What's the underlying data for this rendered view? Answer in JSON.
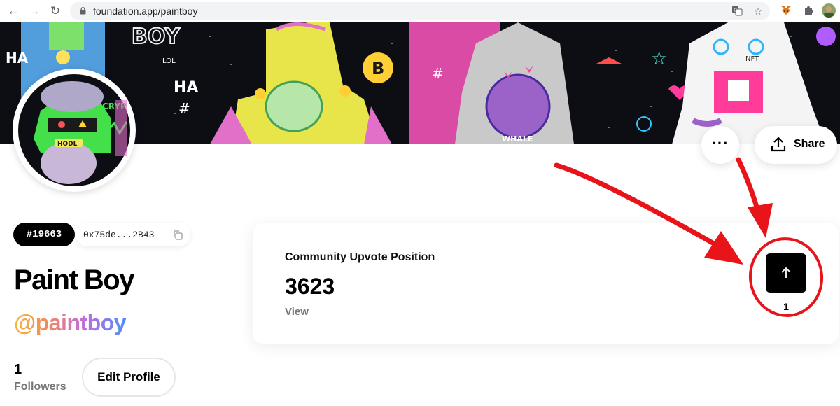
{
  "browser": {
    "url": "foundation.app/paintboy"
  },
  "profile": {
    "number_badge": "#19663",
    "wallet_address": "0x75de...2B43",
    "display_name": "Paint Boy",
    "username": "@paintboy",
    "followers_count": "1",
    "followers_label": "Followers",
    "edit_profile_label": "Edit Profile"
  },
  "actions": {
    "share_label": "Share"
  },
  "upvote_card": {
    "title": "Community Upvote Position",
    "position_value": "3623",
    "view_link": "View",
    "upvote_count": "1"
  },
  "colors": {
    "annotation": "#e8141a",
    "button_dark": "#000000",
    "username_gradient": [
      "#f5b53d",
      "#f08a5d",
      "#c86dd7",
      "#4f8df7"
    ]
  },
  "icons": [
    "back-arrow-icon",
    "forward-arrow-icon",
    "reload-icon",
    "lock-icon",
    "translate-icon",
    "bookmark-star-icon",
    "metamask-fox-icon",
    "extensions-puzzle-icon",
    "user-avatar-icon",
    "more-dots-icon",
    "share-upload-icon",
    "copy-icon",
    "upvote-arrow-icon"
  ]
}
